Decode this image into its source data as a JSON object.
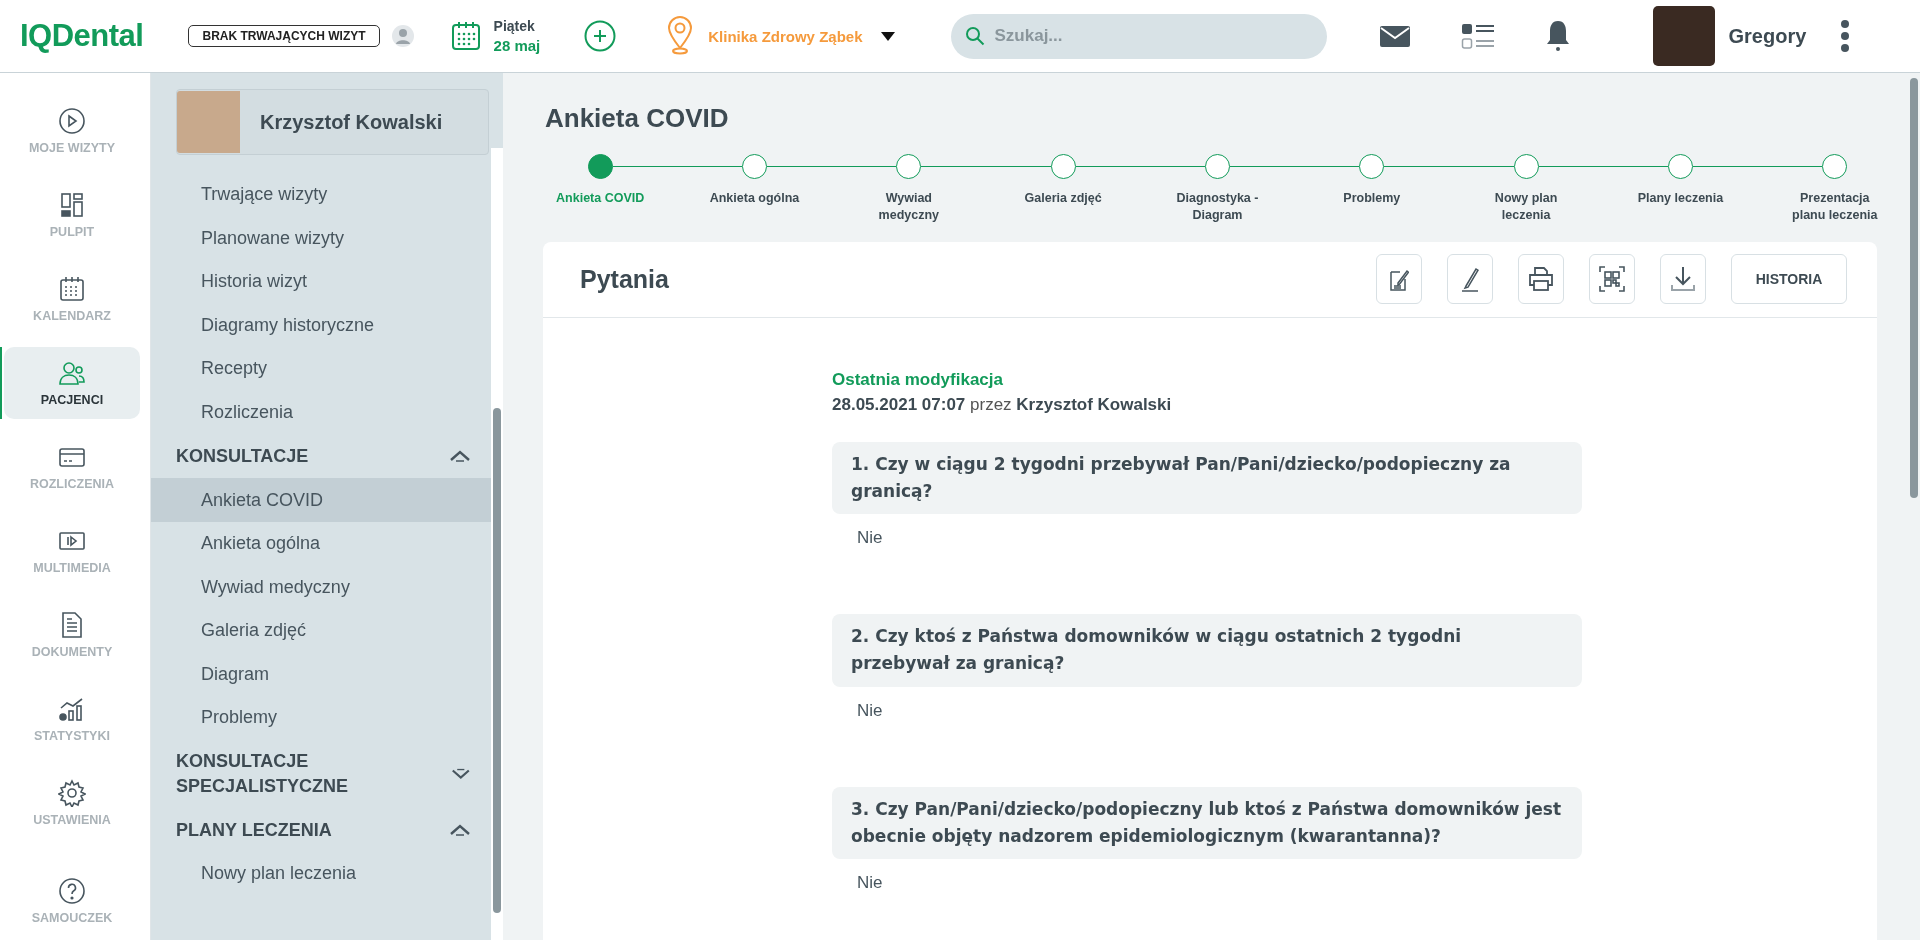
{
  "topbar": {
    "logo": "IQDental",
    "visit_status": "BRAK TRWAJĄCYCH WIZYT",
    "day": "Piątek",
    "date": "28 maj",
    "clinic": "Klinika Zdrowy Ząbek",
    "search": {
      "placeholder": "Szukaj..."
    },
    "user": "Gregory"
  },
  "nav": [
    {
      "label": "MOJE WIZYTY",
      "selected": false
    },
    {
      "label": "PULPIT",
      "selected": false
    },
    {
      "label": "KALENDARZ",
      "selected": false
    },
    {
      "label": "PACJENCI",
      "selected": true
    },
    {
      "label": "ROZLICZENIA",
      "selected": false
    },
    {
      "label": "MULTIMEDIA",
      "selected": false
    },
    {
      "label": "DOKUMENTY",
      "selected": false
    },
    {
      "label": "STATYSTYKI",
      "selected": false
    },
    {
      "label": "USTAWIENIA",
      "selected": false
    },
    {
      "label": "SAMOUCZEK",
      "selected": false
    }
  ],
  "patient": {
    "name": "Krzysztof Kowalski"
  },
  "submenu": [
    {
      "items": [
        {
          "label": "Trwające wizyty",
          "selected": false
        },
        {
          "label": "Planowane wizyty",
          "selected": false
        },
        {
          "label": "Historia wizyt",
          "selected": false
        },
        {
          "label": "Diagramy historyczne",
          "selected": false
        },
        {
          "label": "Recepty",
          "selected": false
        },
        {
          "label": "Rozliczenia",
          "selected": false
        }
      ]
    },
    {
      "title": "KONSULTACJE",
      "expanded": true,
      "items": [
        {
          "label": "Ankieta COVID",
          "selected": true
        },
        {
          "label": "Ankieta ogólna",
          "selected": false
        },
        {
          "label": "Wywiad medyczny",
          "selected": false
        },
        {
          "label": "Galeria zdjęć",
          "selected": false
        },
        {
          "label": "Diagram",
          "selected": false
        },
        {
          "label": "Problemy",
          "selected": false
        }
      ]
    },
    {
      "title": "KONSULTACJE SPECJALISTYCZNE",
      "expanded": false
    },
    {
      "title": "PLANY LECZENIA",
      "expanded": true,
      "items": [
        {
          "label": "Nowy plan leczenia",
          "selected": false
        }
      ]
    }
  ],
  "page_title": "Ankieta COVID",
  "steps": [
    {
      "label": "Ankieta COVID",
      "selected": true
    },
    {
      "label": "Ankieta ogólna",
      "selected": false
    },
    {
      "label": "Wywiad medyczny",
      "selected": false
    },
    {
      "label": "Galeria zdjęć",
      "selected": false
    },
    {
      "label": "Diagnostyka - Diagram",
      "selected": false
    },
    {
      "label": "Problemy",
      "selected": false
    },
    {
      "label": "Nowy plan leczenia",
      "selected": false
    },
    {
      "label": "Plany leczenia",
      "selected": false
    },
    {
      "label": "Prezentacja planu leczenia",
      "selected": false
    }
  ],
  "card": {
    "title": "Pytania",
    "history_button": "HISTORIA",
    "modified_label": "Ostatnia modyfikacja",
    "modified_text": "**28.05.2021 07:07** przez **Krzysztof Kowalski**",
    "questions": [
      {
        "question": "1. Czy w ciągu 2 tygodni przebywał Pan/Pani/dziecko/podopieczny za granicą?",
        "answer": "Nie"
      },
      {
        "question": "2. Czy ktoś z Państwa domowników w ciągu ostatnich 2 tygodni przebywał za granicą?",
        "answer": "Nie"
      },
      {
        "question": "3. Czy Pan/Pani/dziecko/podopieczny lub ktoś z Państwa domowników jest obecnie objęty nadzorem epidemiologicznym (kwarantanna)?",
        "answer": "Nie"
      }
    ]
  }
}
